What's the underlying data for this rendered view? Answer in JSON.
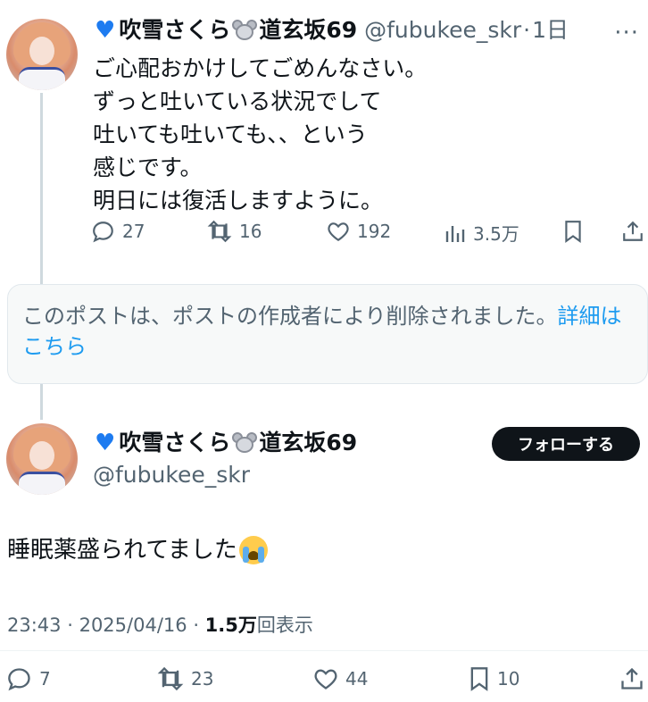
{
  "first_tweet": {
    "display_name": "吹雪さくら",
    "location_name": "道玄坂69",
    "handle": "@fubukee_skr",
    "time": "1日",
    "lines": [
      "ご心配おかけしてごめんなさい。",
      "ずっと吐いている状況でして",
      "吐いても吐いても、、という",
      "感じです。",
      "明日には復活しますように。"
    ],
    "replies": "27",
    "retweets": "16",
    "likes": "192",
    "views": "3.5万"
  },
  "deleted_notice": {
    "text": "このポストは、ポストの作成者により削除されました。",
    "link": "詳細はこちら"
  },
  "main_tweet": {
    "display_name": "吹雪さくら",
    "location_name": "道玄坂69",
    "handle": "@fubukee_skr",
    "follow_label": "フォローする",
    "text": "睡眠薬盛られてました",
    "time": "23:43",
    "date": "2025/04/16",
    "view_count": "1.5万",
    "view_suffix": "回表示",
    "replies": "7",
    "retweets": "23",
    "likes": "44",
    "bookmarks": "10"
  },
  "icons": {
    "verified_heart": "blue-heart-icon",
    "mouse": "mouse-face-icon",
    "crying": "loudly-crying-face-icon"
  },
  "colors": {
    "accent": "#1d9bf0",
    "text": "#0f1419",
    "muted": "#536471",
    "heart": "#1d7bf0"
  }
}
